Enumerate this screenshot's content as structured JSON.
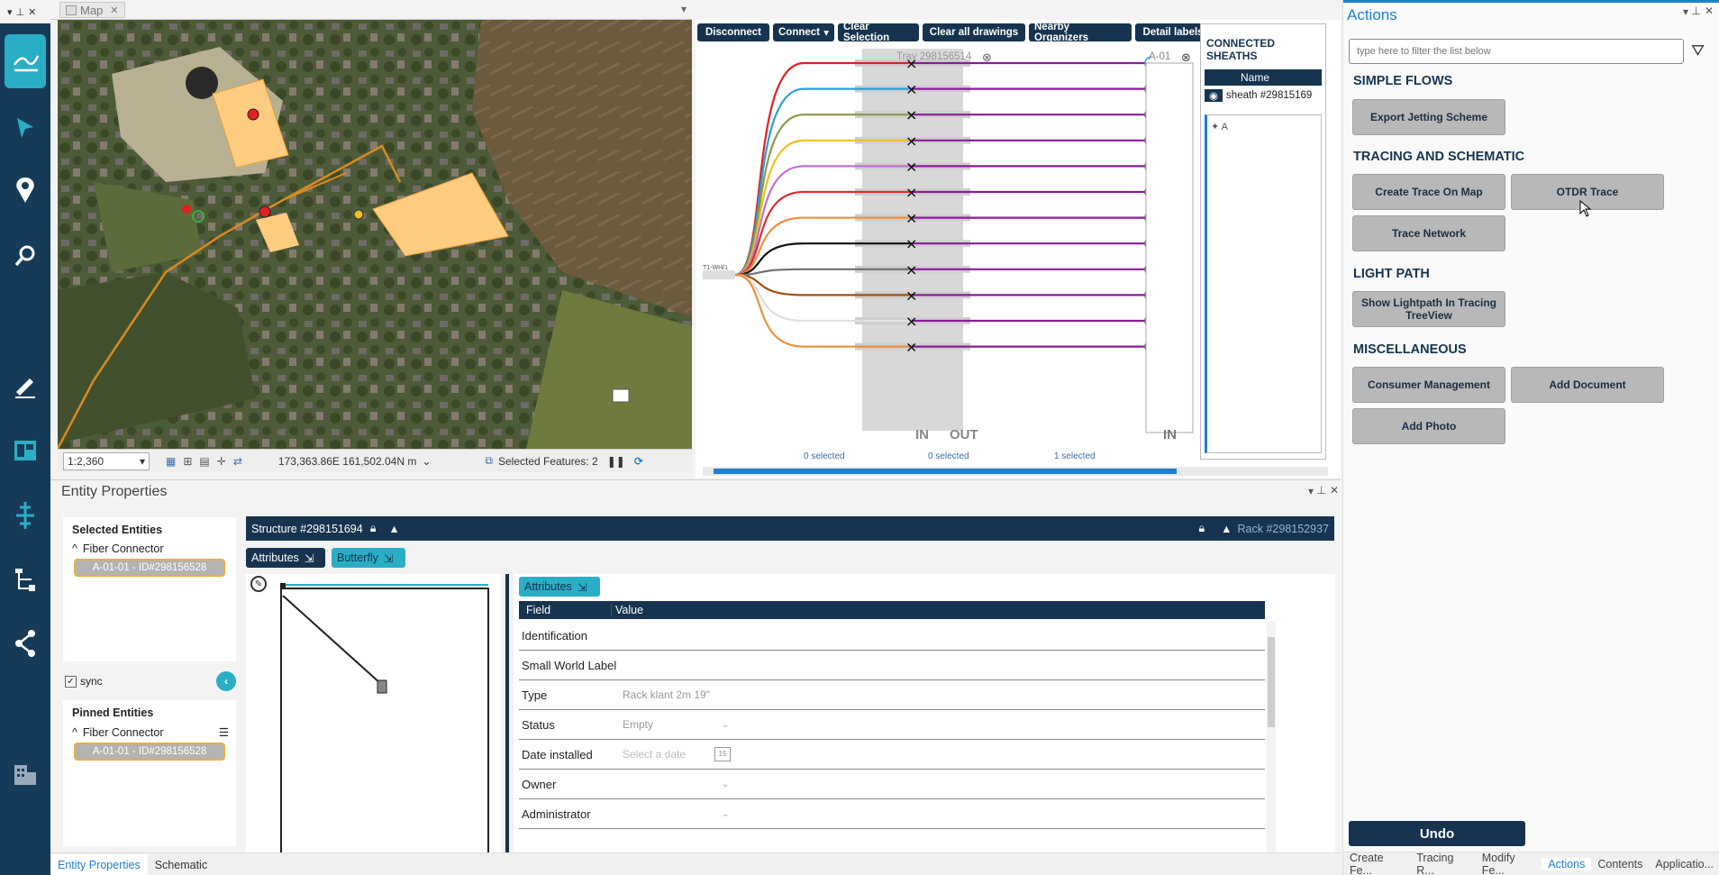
{
  "map_panel": {
    "tab_label": "Map",
    "scale": "1:2,360",
    "coords": "173,363.86E 161,502.04N m",
    "selected_features": "Selected Features: 2"
  },
  "schematic": {
    "toolbar": [
      "Disconnect",
      "Connect",
      "Clear Selection",
      "Clear all drawings",
      "Nearby Organizers",
      "Detail labels"
    ],
    "tray_label": "Tray 298156514",
    "rack_label": "A-01",
    "cable_label": "T1-WH/1",
    "in_label": "IN",
    "out_label": "OUT",
    "rack_in_label": "IN",
    "selected_counts": [
      "0 selected",
      "0 selected",
      "1 selected"
    ],
    "fiber_colors": [
      "#e02020",
      "#2a9fd8",
      "#8a9a48",
      "#f0c020",
      "#c070d0",
      "#d83030",
      "#f09040",
      "#111111",
      "#707070",
      "#a05010",
      "#e0e0e0",
      "#f09040"
    ],
    "out_color": "#8a1a9a",
    "connected_sheaths": {
      "title": "CONNECTED SHEATHS",
      "col_name": "Name",
      "row": "sheath #29815169",
      "tree_item": "A"
    }
  },
  "actions": {
    "title": "Actions",
    "filter_placeholder": "type here to filter the list below",
    "sections": {
      "simple_flows": "SIMPLE FLOWS",
      "tracing": "TRACING AND SCHEMATIC",
      "light_path": "LIGHT PATH",
      "misc": "MISCELLANEOUS"
    },
    "buttons": {
      "export_jetting": "Export Jetting Scheme",
      "create_trace": "Create Trace On Map",
      "otdr_trace": "OTDR Trace",
      "trace_network": "Trace Network",
      "show_lightpath": "Show Lightpath In Tracing TreeView",
      "consumer_mgmt": "Consumer Management",
      "add_document": "Add Document",
      "add_photo": "Add Photo",
      "undo": "Undo"
    },
    "bottom_tabs": [
      "Create Fe...",
      "Tracing R...",
      "Modify Fe...",
      "Actions",
      "Contents",
      "Applicatio..."
    ]
  },
  "entity": {
    "title": "Entity Properties",
    "selected_title": "Selected Entities",
    "selected_group": "Fiber Connector",
    "selected_item": "A-01-01 - ID#298156528",
    "sync_label": "sync",
    "pinned_title": "Pinned Entities",
    "pinned_group": "Fiber Connector",
    "pinned_item": "A-01-01 - ID#298156528",
    "structure": "Structure #298151694",
    "rack": "Rack #298152937",
    "attributes_tab": "Attributes",
    "butterfly_tab": "Butterfly",
    "attributes_btn": "Attributes",
    "col_field": "Field",
    "col_value": "Value",
    "fields": [
      {
        "label": "Identification",
        "value": ""
      },
      {
        "label": "Small World Label",
        "value": ""
      },
      {
        "label": "Type",
        "value": "Rack klant 2m 19\""
      },
      {
        "label": "Status",
        "value": "Empty"
      },
      {
        "label": "Date installed",
        "value": "Select a date"
      },
      {
        "label": "Owner",
        "value": ""
      },
      {
        "label": "Administrator",
        "value": ""
      }
    ],
    "bottom_tabs": [
      "Entity Properties",
      "Schematic"
    ]
  }
}
